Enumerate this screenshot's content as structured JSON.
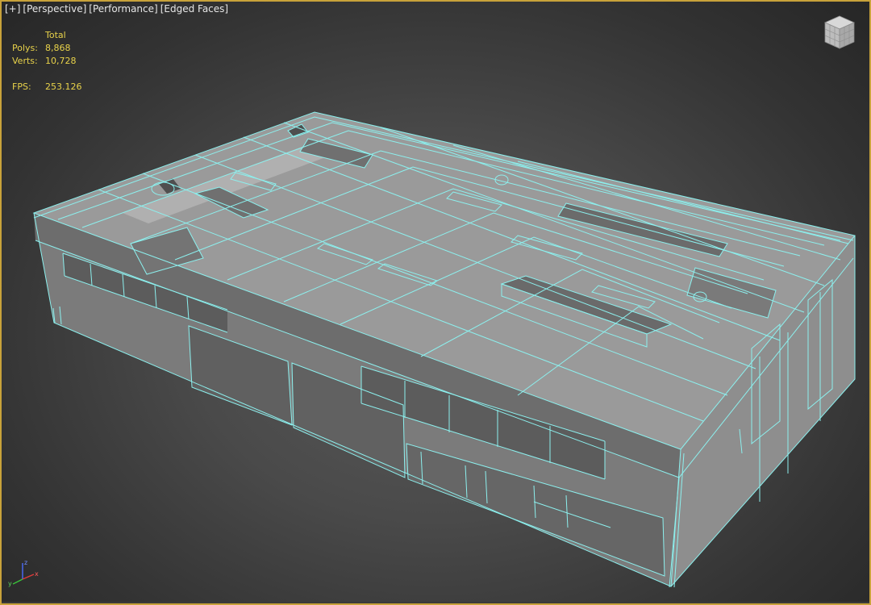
{
  "viewport": {
    "labels": {
      "plus": "[+]",
      "view": "[Perspective]",
      "shading": "[Performance]",
      "edges": "[Edged Faces]"
    },
    "stats": {
      "header": "Total",
      "polys_label": "Polys:",
      "polys_value": "8,868",
      "verts_label": "Verts:",
      "verts_value": "10,728",
      "fps_label": "FPS:",
      "fps_value": "253.126"
    },
    "axis": {
      "x": "x",
      "y": "y",
      "z": "z"
    },
    "colors": {
      "wire": "#8cf0ee",
      "face_top": "#9a9a9a",
      "face_front": "#7c7c7c",
      "face_side": "#8d8d8d",
      "active_border": "#c8a23a",
      "stats_text": "#e8d24a"
    }
  }
}
